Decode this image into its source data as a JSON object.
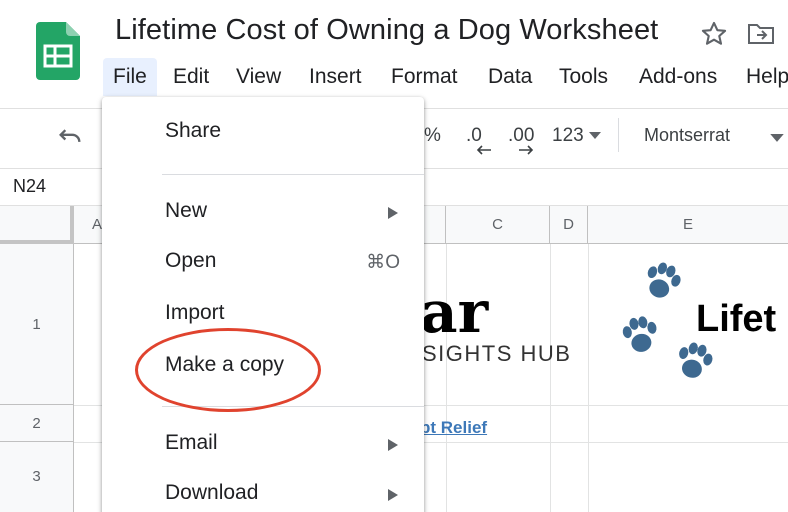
{
  "document": {
    "title": "Lifetime Cost of Owning a Dog Worksheet"
  },
  "menubar": {
    "items": [
      {
        "label": "File"
      },
      {
        "label": "Edit"
      },
      {
        "label": "View"
      },
      {
        "label": "Insert"
      },
      {
        "label": "Format"
      },
      {
        "label": "Data"
      },
      {
        "label": "Tools"
      },
      {
        "label": "Add-ons"
      },
      {
        "label": "Help"
      }
    ]
  },
  "toolbar": {
    "percent": "%",
    "decrease_decimal": ".0",
    "increase_decimal": ".00",
    "number_format": "123",
    "font": "Montserrat"
  },
  "formula_bar": {
    "cell_ref": "N24"
  },
  "grid": {
    "columns": [
      "A",
      "C",
      "D",
      "E"
    ],
    "rows": [
      "1",
      "2",
      "3"
    ],
    "cells": {
      "brand_partial": "ar",
      "brand_sub": "SIGHTS HUB",
      "link_partial": "bt Relief",
      "heading_partial": "Lifet"
    }
  },
  "file_menu": {
    "items": [
      {
        "label": "Share",
        "shortcut": "",
        "submenu": false
      },
      {
        "label": "New",
        "shortcut": "",
        "submenu": true
      },
      {
        "label": "Open",
        "shortcut": "⌘O",
        "submenu": false
      },
      {
        "label": "Import",
        "shortcut": "",
        "submenu": false
      },
      {
        "label": "Make a copy",
        "shortcut": "",
        "submenu": false
      },
      {
        "label": "Email",
        "shortcut": "",
        "submenu": true
      },
      {
        "label": "Download",
        "shortcut": "",
        "submenu": true
      }
    ]
  },
  "colors": {
    "sheets_green": "#23a566",
    "menu_active_bg": "#e8f0fe",
    "annotation_red": "#e0432e",
    "paw_blue": "#3e6990",
    "link_blue": "#3d78b8"
  }
}
